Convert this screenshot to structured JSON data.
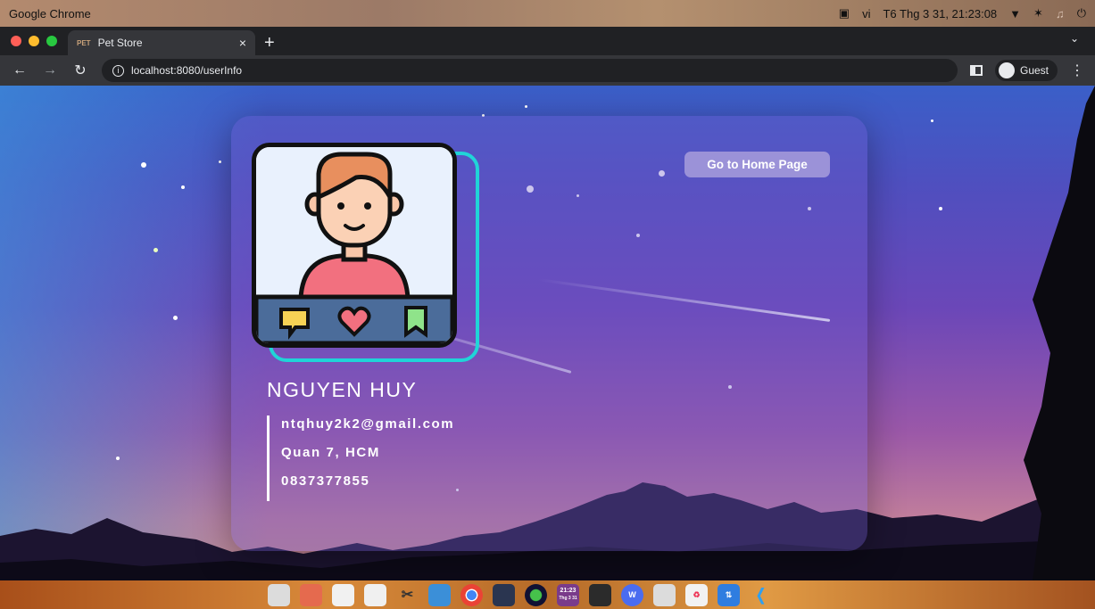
{
  "os_bar": {
    "app_name": "Google Chrome",
    "language": "vi",
    "datetime": "T6 Thg 3 31, 21:23:08"
  },
  "browser": {
    "tab": {
      "favicon_text": "PET",
      "title": "Pet Store"
    },
    "new_tab_symbol": "+",
    "url": "localhost:8080/userInfo",
    "profile_label": "Guest"
  },
  "profile_card": {
    "name": "NGUYEN HUY",
    "email": "ntqhuy2k2@gmail.com",
    "address": "Quan 7, HCM",
    "phone": "0837377855",
    "home_button_label": "Go to Home Page"
  },
  "dock": {
    "clock_time": "21:23",
    "clock_date": "Thg 3 31",
    "apps": [
      "files-icon",
      "screenshot-icon",
      "document-viewer-icon",
      "text-editor-icon",
      "cut-tool-icon",
      "desktop-icon",
      "chrome-icon",
      "system-monitor-icon",
      "disk-usage-icon",
      "clock-icon",
      "terminal-icon",
      "wps-office-icon",
      "camera-icon",
      "recycle-icon",
      "transfer-icon",
      "vscode-icon"
    ]
  },
  "colors": {
    "accent_outline": "#20d4d8",
    "button_bg": "#9b92d8",
    "card_bg": "rgba(110,90,200,0.35)"
  }
}
